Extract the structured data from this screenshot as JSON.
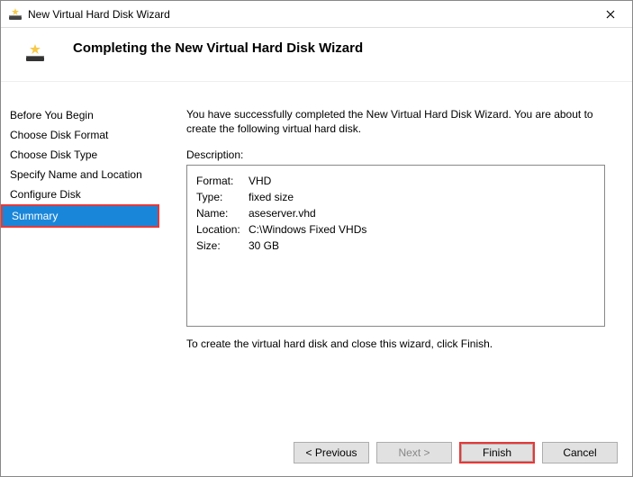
{
  "titlebar": {
    "title": "New Virtual Hard Disk Wizard"
  },
  "header": {
    "title": "Completing the New Virtual Hard Disk Wizard"
  },
  "sidebar": {
    "items": [
      {
        "label": "Before You Begin",
        "active": false
      },
      {
        "label": "Choose Disk Format",
        "active": false
      },
      {
        "label": "Choose Disk Type",
        "active": false
      },
      {
        "label": "Specify Name and Location",
        "active": false
      },
      {
        "label": "Configure Disk",
        "active": false
      },
      {
        "label": "Summary",
        "active": true
      }
    ]
  },
  "content": {
    "intro": "You have successfully completed the New Virtual Hard Disk Wizard. You are about to create the following virtual hard disk.",
    "description_label": "Description:",
    "rows": [
      {
        "key": "Format:",
        "value": "VHD"
      },
      {
        "key": "Type:",
        "value": "fixed size"
      },
      {
        "key": "Name:",
        "value": "aseserver.vhd"
      },
      {
        "key": "Location:",
        "value": "C:\\Windows Fixed VHDs"
      },
      {
        "key": "Size:",
        "value": "30 GB"
      }
    ],
    "instruction": "To create the virtual hard disk and close this wizard, click Finish."
  },
  "buttons": {
    "previous": "< Previous",
    "next": "Next >",
    "finish": "Finish",
    "cancel": "Cancel"
  }
}
